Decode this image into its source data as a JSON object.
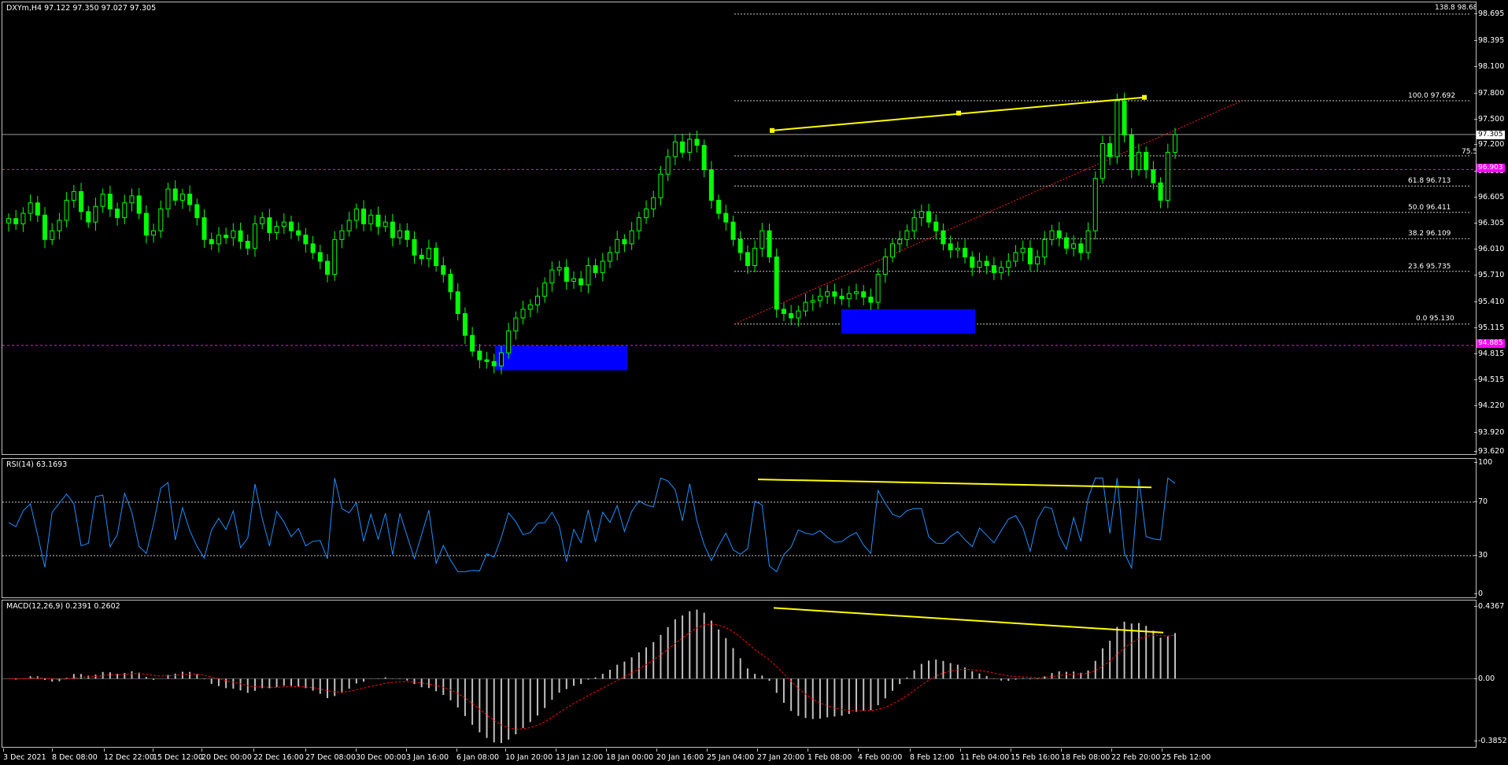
{
  "chart": {
    "title": "DXYm,H4  97.122 97.350 97.027 97.305",
    "bid_label": "97.305",
    "level_upper_label": "96.903",
    "level_lower_label": "94.885",
    "price_axis": [
      "98.695",
      "98.395",
      "98.100",
      "97.800",
      "97.500",
      "97.200",
      "96.905",
      "96.605",
      "96.305",
      "96.010",
      "95.710",
      "95.410",
      "95.115",
      "94.815",
      "94.515",
      "94.220",
      "93.920",
      "93.620"
    ],
    "fibo": [
      "138.8 98.686",
      "100.0 97.692",
      "75.5",
      "61.8 96.713",
      "50.0 96.411",
      "38.2 96.109",
      "23.6 95.735",
      "0.0 95.130"
    ]
  },
  "rsi": {
    "title": "RSI(14) 63.1693",
    "axis": [
      "100",
      "70",
      "30",
      "0"
    ]
  },
  "macd": {
    "title": "MACD(12,26,9) 0.2391 0.2602",
    "axis": [
      "0.4367",
      "0.00",
      "-0.3852"
    ]
  },
  "time_axis": [
    "3 Dec 2021",
    "8 Dec 08:00",
    "12 Dec 22:00",
    "15 Dec 12:00",
    "20 Dec 00:00",
    "22 Dec 16:00",
    "27 Dec 08:00",
    "30 Dec 00:00",
    "3 Jan 16:00",
    "6 Jan 08:00",
    "10 Jan 20:00",
    "13 Jan 12:00",
    "18 Jan 00:00",
    "20 Jan 16:00",
    "25 Jan 04:00",
    "27 Jan 20:00",
    "1 Feb 08:00",
    "4 Feb 00:00",
    "8 Feb 12:00",
    "11 Feb 04:00",
    "15 Feb 16:00",
    "18 Feb 08:00",
    "22 Feb 20:00",
    "25 Feb 12:00"
  ],
  "colors": {
    "candle": "#00ff00",
    "trendline": "#ffff00",
    "box": "#0000ff",
    "level": "#ff00ff",
    "rsi": "#1e90ff",
    "macd_signal": "#ff0000"
  },
  "chart_data": {
    "type": "line",
    "title": "DXYm,H4",
    "ohlc_last": {
      "open": 97.122,
      "high": 97.35,
      "low": 97.027,
      "close": 97.305
    },
    "y_range": [
      93.62,
      98.82
    ],
    "x_range": [
      "3 Dec 2021",
      "25 Feb 12:00"
    ],
    "series": [
      {
        "values": [
          96.34,
          96.28,
          96.4,
          96.52,
          96.38,
          96.1,
          96.2,
          96.32,
          96.55,
          96.65,
          96.42,
          96.3,
          96.48,
          96.62,
          96.45,
          96.35,
          96.52,
          96.6,
          96.4,
          96.15,
          96.2,
          96.45,
          96.68,
          96.55,
          96.62,
          96.5,
          96.35,
          96.1,
          96.05,
          96.15,
          96.12,
          96.2,
          96.08,
          96.0,
          96.28,
          96.35,
          96.18,
          96.25,
          96.3,
          96.2,
          96.15,
          96.05,
          95.95,
          95.85,
          95.7,
          96.1,
          96.2,
          96.32,
          96.45,
          96.28,
          96.38,
          96.25,
          96.3,
          96.12,
          96.2,
          96.1,
          95.92,
          95.88,
          96.0,
          95.8,
          95.7,
          95.5,
          95.25,
          95.0,
          94.82,
          94.72,
          94.7,
          94.65,
          94.8,
          95.05,
          95.2,
          95.3,
          95.35,
          95.45,
          95.6,
          95.75,
          95.78,
          95.62,
          95.65,
          95.58,
          95.8,
          95.72,
          95.85,
          95.95,
          96.1,
          96.05,
          96.2,
          96.35,
          96.45,
          96.58,
          96.85,
          97.05,
          97.22,
          97.1,
          97.25,
          97.18,
          96.9,
          96.55,
          96.4,
          96.3,
          96.1,
          95.95,
          95.8,
          96.0,
          96.2,
          95.9,
          95.3,
          95.25,
          95.2,
          95.28,
          95.38,
          95.4,
          95.45,
          95.5,
          95.45,
          95.42,
          95.48,
          95.5,
          95.44,
          95.38,
          95.7,
          95.9,
          96.05,
          96.1,
          96.2,
          96.35,
          96.42,
          96.3,
          96.2,
          96.05,
          95.98,
          96.0,
          95.9,
          95.78,
          95.85,
          95.8,
          95.72,
          95.78,
          95.85,
          95.95,
          96.0,
          95.82,
          95.9,
          96.1,
          96.2,
          96.12,
          96.0,
          96.05,
          95.95,
          96.2,
          96.8,
          97.2,
          97.05,
          97.69,
          97.3,
          96.9,
          97.1,
          96.9,
          96.75,
          96.55,
          97.1,
          97.305
        ]
      }
    ],
    "fibonacci": [
      {
        "level": "138.8",
        "price": 98.686
      },
      {
        "level": "100.0",
        "price": 97.692
      },
      {
        "level": "75.5",
        "price": 97.06
      },
      {
        "level": "61.8",
        "price": 96.713
      },
      {
        "level": "50.0",
        "price": 96.411
      },
      {
        "level": "38.2",
        "price": 96.109
      },
      {
        "level": "23.6",
        "price": 95.735
      },
      {
        "level": "0.0",
        "price": 95.13
      }
    ],
    "horizontal_levels": [
      96.903,
      94.885,
      97.305
    ],
    "rsi": {
      "period": 14,
      "last": 63.1693,
      "levels": [
        70,
        30
      ],
      "range": [
        0,
        100
      ]
    },
    "macd": {
      "params": [
        12,
        26,
        9
      ],
      "main": 0.2391,
      "signal": 0.2602,
      "range": [
        -0.3852,
        0.4367
      ]
    }
  }
}
